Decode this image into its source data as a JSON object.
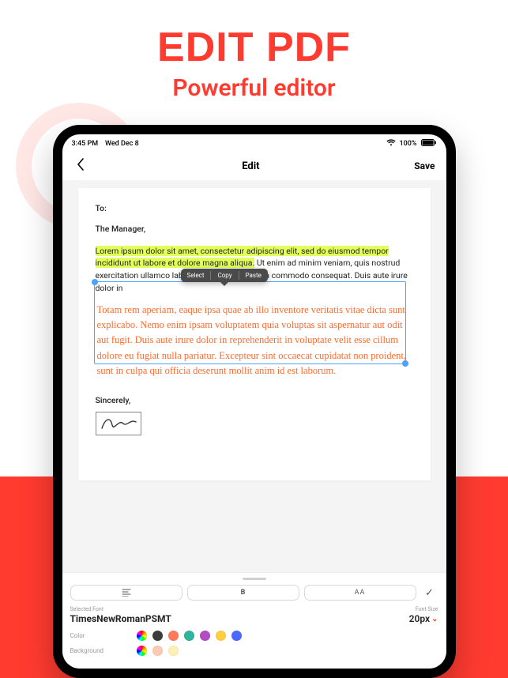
{
  "promo": {
    "title": "EDIT PDF",
    "subtitle": "Powerful editor"
  },
  "statusbar": {
    "time": "3:45 PM",
    "date": "Wed Dec 8",
    "battery": "100%"
  },
  "nav": {
    "title": "Edit",
    "save": "Save"
  },
  "doc": {
    "to": "To:",
    "manager": "The Manager,",
    "para1_highlight": "Lorem ipsum dolor sit amet, consectetur adipiscing elit, sed do eiusmod tempor incididunt ut labore et dolore magna aliqua.",
    "para1_rest": " Ut enim ad minim veniam, quis nostrud exercitation ullamco laboris nisi ut aliquip ex ea commodo consequat. Duis aute irure dolor in",
    "para2": "Totam rem aperiam, eaque ipsa quae ab illo inventore veritatis vitae dicta sunt explicabo. Nemo enim ipsam voluptatem quia voluptas sit aspernatur aut odit aut fugit. Duis aute irure dolor in reprehenderit in voluptate velit esse cillum dolore eu fugiat nulla pariatur. Excepteur sint occaecat cupidatat non proident, sunt in culpa qui officia deserunt mollit anim id est laborum.",
    "sincerely": "Sincerely,"
  },
  "context_menu": {
    "select": "Select",
    "copy": "Copy",
    "paste": "Paste"
  },
  "toolbar": {
    "bold": "B",
    "caps": "AA",
    "selected_font_label": "Selected Font",
    "font_size_label": "Font Size",
    "font_name": "TimesNewRomanPSMT",
    "font_size": "20px",
    "color_label": "Color",
    "background_label": "Background",
    "text_colors": [
      "picker",
      "#3b3b3b",
      "#ff7a59",
      "#2fb69a",
      "#b44cc5",
      "#ffcf3f",
      "#4a69ff"
    ],
    "bg_colors": [
      "picker",
      "#ffc9b3",
      "#fff0b3"
    ]
  }
}
